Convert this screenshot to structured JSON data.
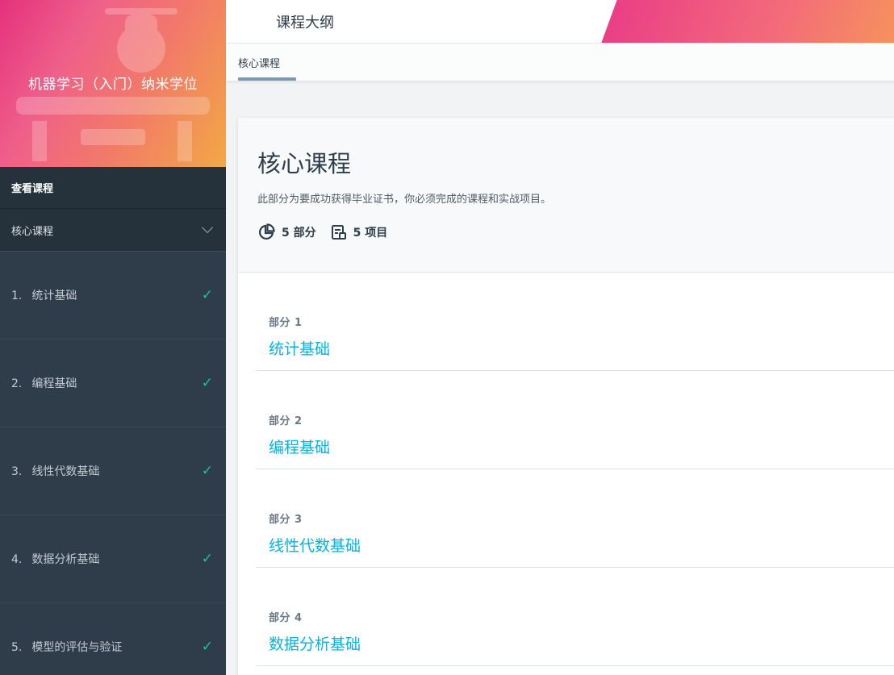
{
  "sidebar": {
    "program_title": "机器学习（入门）纳米学位",
    "view_courses": "查看课程",
    "section_label": "核心课程",
    "items": [
      {
        "num": "1.",
        "label": "统计基础",
        "done": "✓"
      },
      {
        "num": "2.",
        "label": "编程基础",
        "done": "✓"
      },
      {
        "num": "3.",
        "label": "线性代数基础",
        "done": "✓"
      },
      {
        "num": "4.",
        "label": "数据分析基础",
        "done": "✓"
      },
      {
        "num": "5.",
        "label": "模型的评估与验证",
        "done": "✓"
      }
    ]
  },
  "header": {
    "title": "课程大纲",
    "tab": "核心课程"
  },
  "main": {
    "title": "核心课程",
    "description": "此部分为要成功获得毕业证书，你必须完成的课程和实战项目。",
    "sections_count": "5 部分",
    "projects_count": "5 项目",
    "parts": [
      {
        "label": "部分 1",
        "title": "统计基础"
      },
      {
        "label": "部分 2",
        "title": "编程基础"
      },
      {
        "label": "部分 3",
        "title": "线性代数基础"
      },
      {
        "label": "部分 4",
        "title": "数据分析基础"
      }
    ]
  },
  "colors": {
    "sidebar_bg": "#2e3d49",
    "accent_link": "#02b3e4",
    "check": "#16c6a4",
    "gradient_start": "#e5317d",
    "gradient_end": "#f2a845"
  },
  "icons": [
    "drone-image",
    "chevron-down-icon",
    "check-icon",
    "pie-chart-icon",
    "project-icon"
  ]
}
